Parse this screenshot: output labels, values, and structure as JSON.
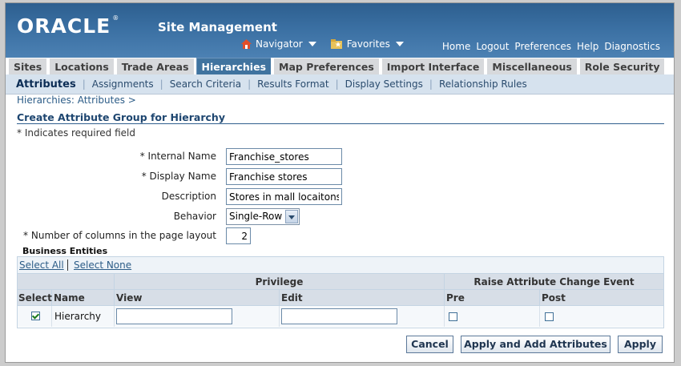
{
  "header": {
    "logo": "ORACLE",
    "logo_mark": "®",
    "app_title": "Site Management",
    "navigator_label": "Navigator",
    "favorites_label": "Favorites",
    "global_links": [
      "Home",
      "Logout",
      "Preferences",
      "Help",
      "Diagnostics"
    ]
  },
  "tabs": [
    {
      "label": "Sites",
      "active": false
    },
    {
      "label": "Locations",
      "active": false
    },
    {
      "label": "Trade Areas",
      "active": false
    },
    {
      "label": "Hierarchies",
      "active": true
    },
    {
      "label": "Map Preferences",
      "active": false
    },
    {
      "label": "Import Interface",
      "active": false
    },
    {
      "label": "Miscellaneous",
      "active": false
    },
    {
      "label": "Role Security",
      "active": false
    }
  ],
  "subtabs": [
    {
      "label": "Attributes",
      "active": true
    },
    {
      "label": "Assignments",
      "active": false
    },
    {
      "label": "Search Criteria",
      "active": false
    },
    {
      "label": "Results Format",
      "active": false
    },
    {
      "label": "Display Settings",
      "active": false
    },
    {
      "label": "Relationship Rules",
      "active": false
    }
  ],
  "breadcrumb": {
    "link": "Hierarchies: Attributes",
    "separator": ">"
  },
  "page": {
    "title": "Create Attribute Group for Hierarchy",
    "required_note": "* Indicates required field"
  },
  "form": {
    "internal_name": {
      "label": "* Internal Name",
      "value": "Franchise_stores"
    },
    "display_name": {
      "label": "* Display Name",
      "value": "Franchise stores"
    },
    "description": {
      "label": "Description",
      "value": "Stores in mall locaitons"
    },
    "behavior": {
      "label": "Behavior",
      "value": "Single-Row"
    },
    "columns": {
      "label": "* Number of columns in the page layout",
      "value": "2"
    }
  },
  "business_entities": {
    "heading": "Business Entities",
    "select_all": "Select All",
    "select_none": "Select None",
    "group_headers": {
      "privilege": "Privilege",
      "raise_event": "Raise Attribute Change Event"
    },
    "columns": {
      "select": "Select",
      "name": "Name",
      "view": "View",
      "edit": "Edit",
      "pre": "Pre",
      "post": "Post"
    },
    "rows": [
      {
        "selected": true,
        "name": "Hierarchy",
        "view": "",
        "edit": "",
        "pre": false,
        "post": false
      }
    ]
  },
  "buttons": {
    "cancel": "Cancel",
    "apply_add": "Apply and Add Attributes",
    "apply": "Apply"
  },
  "colors": {
    "banner": "#3a6fa2",
    "active_tab": "#40739f",
    "subtab_bar": "#d6e2ee",
    "link": "#2c5c87"
  }
}
